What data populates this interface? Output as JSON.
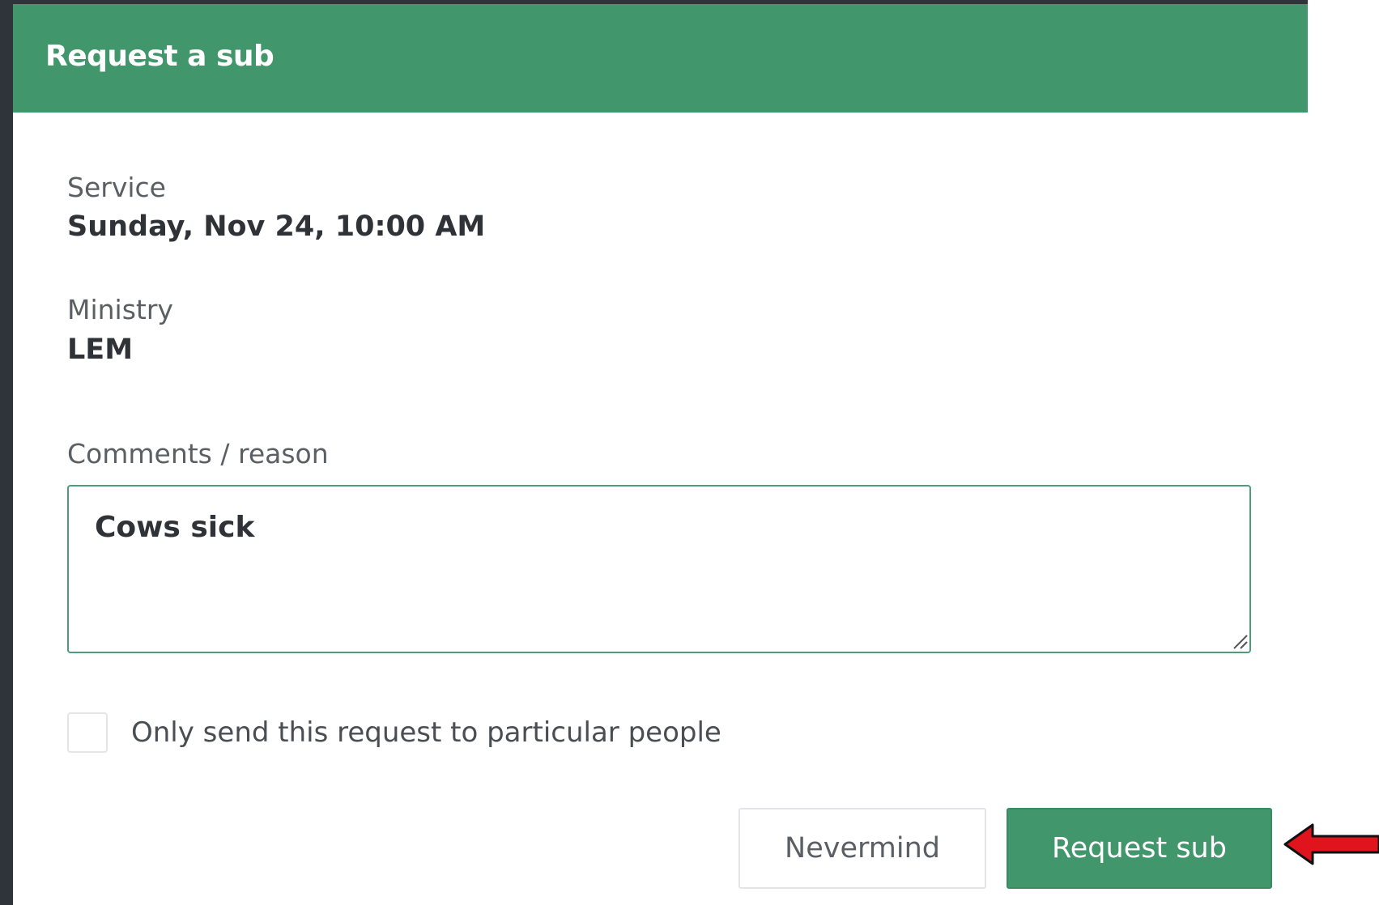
{
  "modal": {
    "title": "Request a sub"
  },
  "fields": {
    "service_label": "Service",
    "service_value": "Sunday, Nov 24, 10:00 AM",
    "ministry_label": "Ministry",
    "ministry_value": "LEM",
    "comments_label": "Comments / reason",
    "comments_value": "Cows sick"
  },
  "options": {
    "particular_people_label": "Only send this request to particular people",
    "particular_people_checked": false
  },
  "actions": {
    "nevermind_label": "Nevermind",
    "request_label": "Request sub"
  },
  "colors": {
    "header_green": "#41976b",
    "annotation_red": "#e0141c"
  },
  "icons": {
    "resize": "resize-handle-icon",
    "annotation": "red-arrow-icon"
  }
}
